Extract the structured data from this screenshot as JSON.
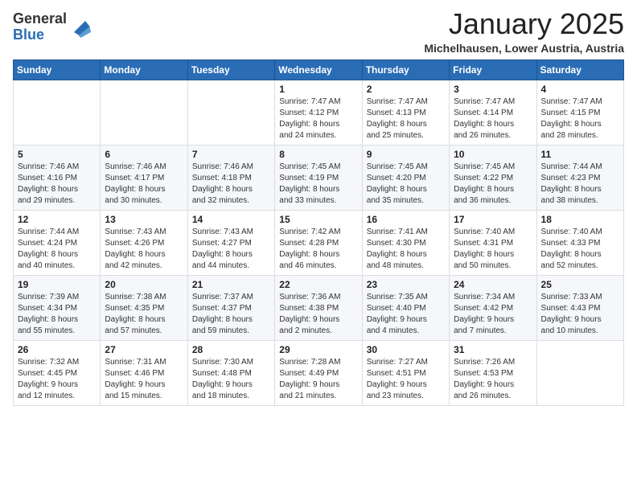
{
  "logo": {
    "general": "General",
    "blue": "Blue"
  },
  "header": {
    "month": "January 2025",
    "location": "Michelhausen, Lower Austria, Austria"
  },
  "weekdays": [
    "Sunday",
    "Monday",
    "Tuesday",
    "Wednesday",
    "Thursday",
    "Friday",
    "Saturday"
  ],
  "weeks": [
    [
      {
        "day": "",
        "info": ""
      },
      {
        "day": "",
        "info": ""
      },
      {
        "day": "",
        "info": ""
      },
      {
        "day": "1",
        "info": "Sunrise: 7:47 AM\nSunset: 4:12 PM\nDaylight: 8 hours\nand 24 minutes."
      },
      {
        "day": "2",
        "info": "Sunrise: 7:47 AM\nSunset: 4:13 PM\nDaylight: 8 hours\nand 25 minutes."
      },
      {
        "day": "3",
        "info": "Sunrise: 7:47 AM\nSunset: 4:14 PM\nDaylight: 8 hours\nand 26 minutes."
      },
      {
        "day": "4",
        "info": "Sunrise: 7:47 AM\nSunset: 4:15 PM\nDaylight: 8 hours\nand 28 minutes."
      }
    ],
    [
      {
        "day": "5",
        "info": "Sunrise: 7:46 AM\nSunset: 4:16 PM\nDaylight: 8 hours\nand 29 minutes."
      },
      {
        "day": "6",
        "info": "Sunrise: 7:46 AM\nSunset: 4:17 PM\nDaylight: 8 hours\nand 30 minutes."
      },
      {
        "day": "7",
        "info": "Sunrise: 7:46 AM\nSunset: 4:18 PM\nDaylight: 8 hours\nand 32 minutes."
      },
      {
        "day": "8",
        "info": "Sunrise: 7:45 AM\nSunset: 4:19 PM\nDaylight: 8 hours\nand 33 minutes."
      },
      {
        "day": "9",
        "info": "Sunrise: 7:45 AM\nSunset: 4:20 PM\nDaylight: 8 hours\nand 35 minutes."
      },
      {
        "day": "10",
        "info": "Sunrise: 7:45 AM\nSunset: 4:22 PM\nDaylight: 8 hours\nand 36 minutes."
      },
      {
        "day": "11",
        "info": "Sunrise: 7:44 AM\nSunset: 4:23 PM\nDaylight: 8 hours\nand 38 minutes."
      }
    ],
    [
      {
        "day": "12",
        "info": "Sunrise: 7:44 AM\nSunset: 4:24 PM\nDaylight: 8 hours\nand 40 minutes."
      },
      {
        "day": "13",
        "info": "Sunrise: 7:43 AM\nSunset: 4:26 PM\nDaylight: 8 hours\nand 42 minutes."
      },
      {
        "day": "14",
        "info": "Sunrise: 7:43 AM\nSunset: 4:27 PM\nDaylight: 8 hours\nand 44 minutes."
      },
      {
        "day": "15",
        "info": "Sunrise: 7:42 AM\nSunset: 4:28 PM\nDaylight: 8 hours\nand 46 minutes."
      },
      {
        "day": "16",
        "info": "Sunrise: 7:41 AM\nSunset: 4:30 PM\nDaylight: 8 hours\nand 48 minutes."
      },
      {
        "day": "17",
        "info": "Sunrise: 7:40 AM\nSunset: 4:31 PM\nDaylight: 8 hours\nand 50 minutes."
      },
      {
        "day": "18",
        "info": "Sunrise: 7:40 AM\nSunset: 4:33 PM\nDaylight: 8 hours\nand 52 minutes."
      }
    ],
    [
      {
        "day": "19",
        "info": "Sunrise: 7:39 AM\nSunset: 4:34 PM\nDaylight: 8 hours\nand 55 minutes."
      },
      {
        "day": "20",
        "info": "Sunrise: 7:38 AM\nSunset: 4:35 PM\nDaylight: 8 hours\nand 57 minutes."
      },
      {
        "day": "21",
        "info": "Sunrise: 7:37 AM\nSunset: 4:37 PM\nDaylight: 8 hours\nand 59 minutes."
      },
      {
        "day": "22",
        "info": "Sunrise: 7:36 AM\nSunset: 4:38 PM\nDaylight: 9 hours\nand 2 minutes."
      },
      {
        "day": "23",
        "info": "Sunrise: 7:35 AM\nSunset: 4:40 PM\nDaylight: 9 hours\nand 4 minutes."
      },
      {
        "day": "24",
        "info": "Sunrise: 7:34 AM\nSunset: 4:42 PM\nDaylight: 9 hours\nand 7 minutes."
      },
      {
        "day": "25",
        "info": "Sunrise: 7:33 AM\nSunset: 4:43 PM\nDaylight: 9 hours\nand 10 minutes."
      }
    ],
    [
      {
        "day": "26",
        "info": "Sunrise: 7:32 AM\nSunset: 4:45 PM\nDaylight: 9 hours\nand 12 minutes."
      },
      {
        "day": "27",
        "info": "Sunrise: 7:31 AM\nSunset: 4:46 PM\nDaylight: 9 hours\nand 15 minutes."
      },
      {
        "day": "28",
        "info": "Sunrise: 7:30 AM\nSunset: 4:48 PM\nDaylight: 9 hours\nand 18 minutes."
      },
      {
        "day": "29",
        "info": "Sunrise: 7:28 AM\nSunset: 4:49 PM\nDaylight: 9 hours\nand 21 minutes."
      },
      {
        "day": "30",
        "info": "Sunrise: 7:27 AM\nSunset: 4:51 PM\nDaylight: 9 hours\nand 23 minutes."
      },
      {
        "day": "31",
        "info": "Sunrise: 7:26 AM\nSunset: 4:53 PM\nDaylight: 9 hours\nand 26 minutes."
      },
      {
        "day": "",
        "info": ""
      }
    ]
  ]
}
